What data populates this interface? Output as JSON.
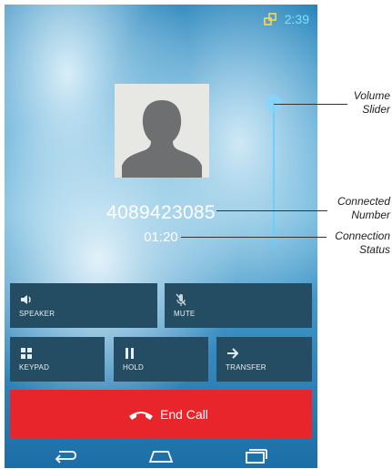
{
  "status_bar": {
    "time": "2:39",
    "network_icon": "network-icon"
  },
  "call": {
    "number": "4089423085",
    "status": "01:20",
    "avatar_icon": "contact-silhouette-icon"
  },
  "buttons": {
    "speaker": {
      "label": "SPEAKER",
      "icon": "speaker-icon"
    },
    "mute": {
      "label": "MUTE",
      "icon": "mute-mic-icon"
    },
    "keypad": {
      "label": "KEYPAD",
      "icon": "keypad-icon"
    },
    "hold": {
      "label": "HOLD",
      "icon": "pause-icon"
    },
    "transfer": {
      "label": "TRANSFER",
      "icon": "arrow-right-icon"
    }
  },
  "end_call": {
    "label": "End Call",
    "icon": "hang-up-icon",
    "color": "#e8252a"
  },
  "navbar": {
    "back": "back-icon",
    "home": "home-icon",
    "recents": "recents-icon"
  },
  "annotations": {
    "volume": {
      "line1": "Volume",
      "line2": "Slider"
    },
    "connected": {
      "line1": "Connected",
      "line2": "Number"
    },
    "connection": {
      "line1": "Connection",
      "line2": "Status"
    }
  },
  "colors": {
    "accent": "#62d0ff",
    "button_bg": "#244d63",
    "end_call": "#e8252a"
  }
}
